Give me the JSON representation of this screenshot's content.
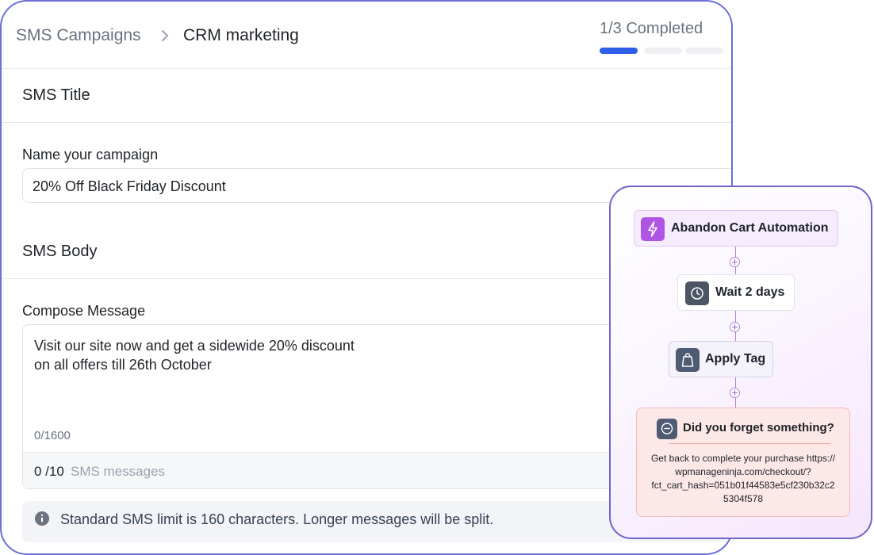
{
  "header": {
    "breadcrumb_root": "SMS Campaigns",
    "breadcrumb_current": "CRM marketing",
    "progress_label": "1/3 Completed",
    "progress": {
      "completed": 1,
      "total": 3
    }
  },
  "sections": {
    "title_heading": "SMS Title",
    "body_heading": "SMS Body"
  },
  "campaign": {
    "name_label": "Name your campaign",
    "name_value": "20% Off Black Friday Discount"
  },
  "compose": {
    "label": "Compose Message",
    "lines": [
      "Visit our site now and get a sidewide 20% discount",
      "on all offers till 26th October"
    ],
    "char_count": "0/1600",
    "sms_count": "0 /10",
    "sms_unit": "SMS messages"
  },
  "note": {
    "text": "Standard SMS limit is 160 characters. Longer messages will be split."
  },
  "automation": {
    "trigger": "Abandon Cart Automation",
    "wait": "Wait 2 days",
    "tag": "Apply Tag",
    "message_title": "Did you forget something?",
    "message_body": [
      "Get back to complete your purchase https://",
      "wpmanageninja.com/checkout/?",
      "fct_cart_hash=051b01f44583e5cf230b32c2",
      "5304f578"
    ]
  },
  "colors": {
    "accent": "#2f5fe8",
    "panel_border": "#7066c8",
    "card_border": "#6b6fd6",
    "trigger_icon": "#b054e6"
  }
}
